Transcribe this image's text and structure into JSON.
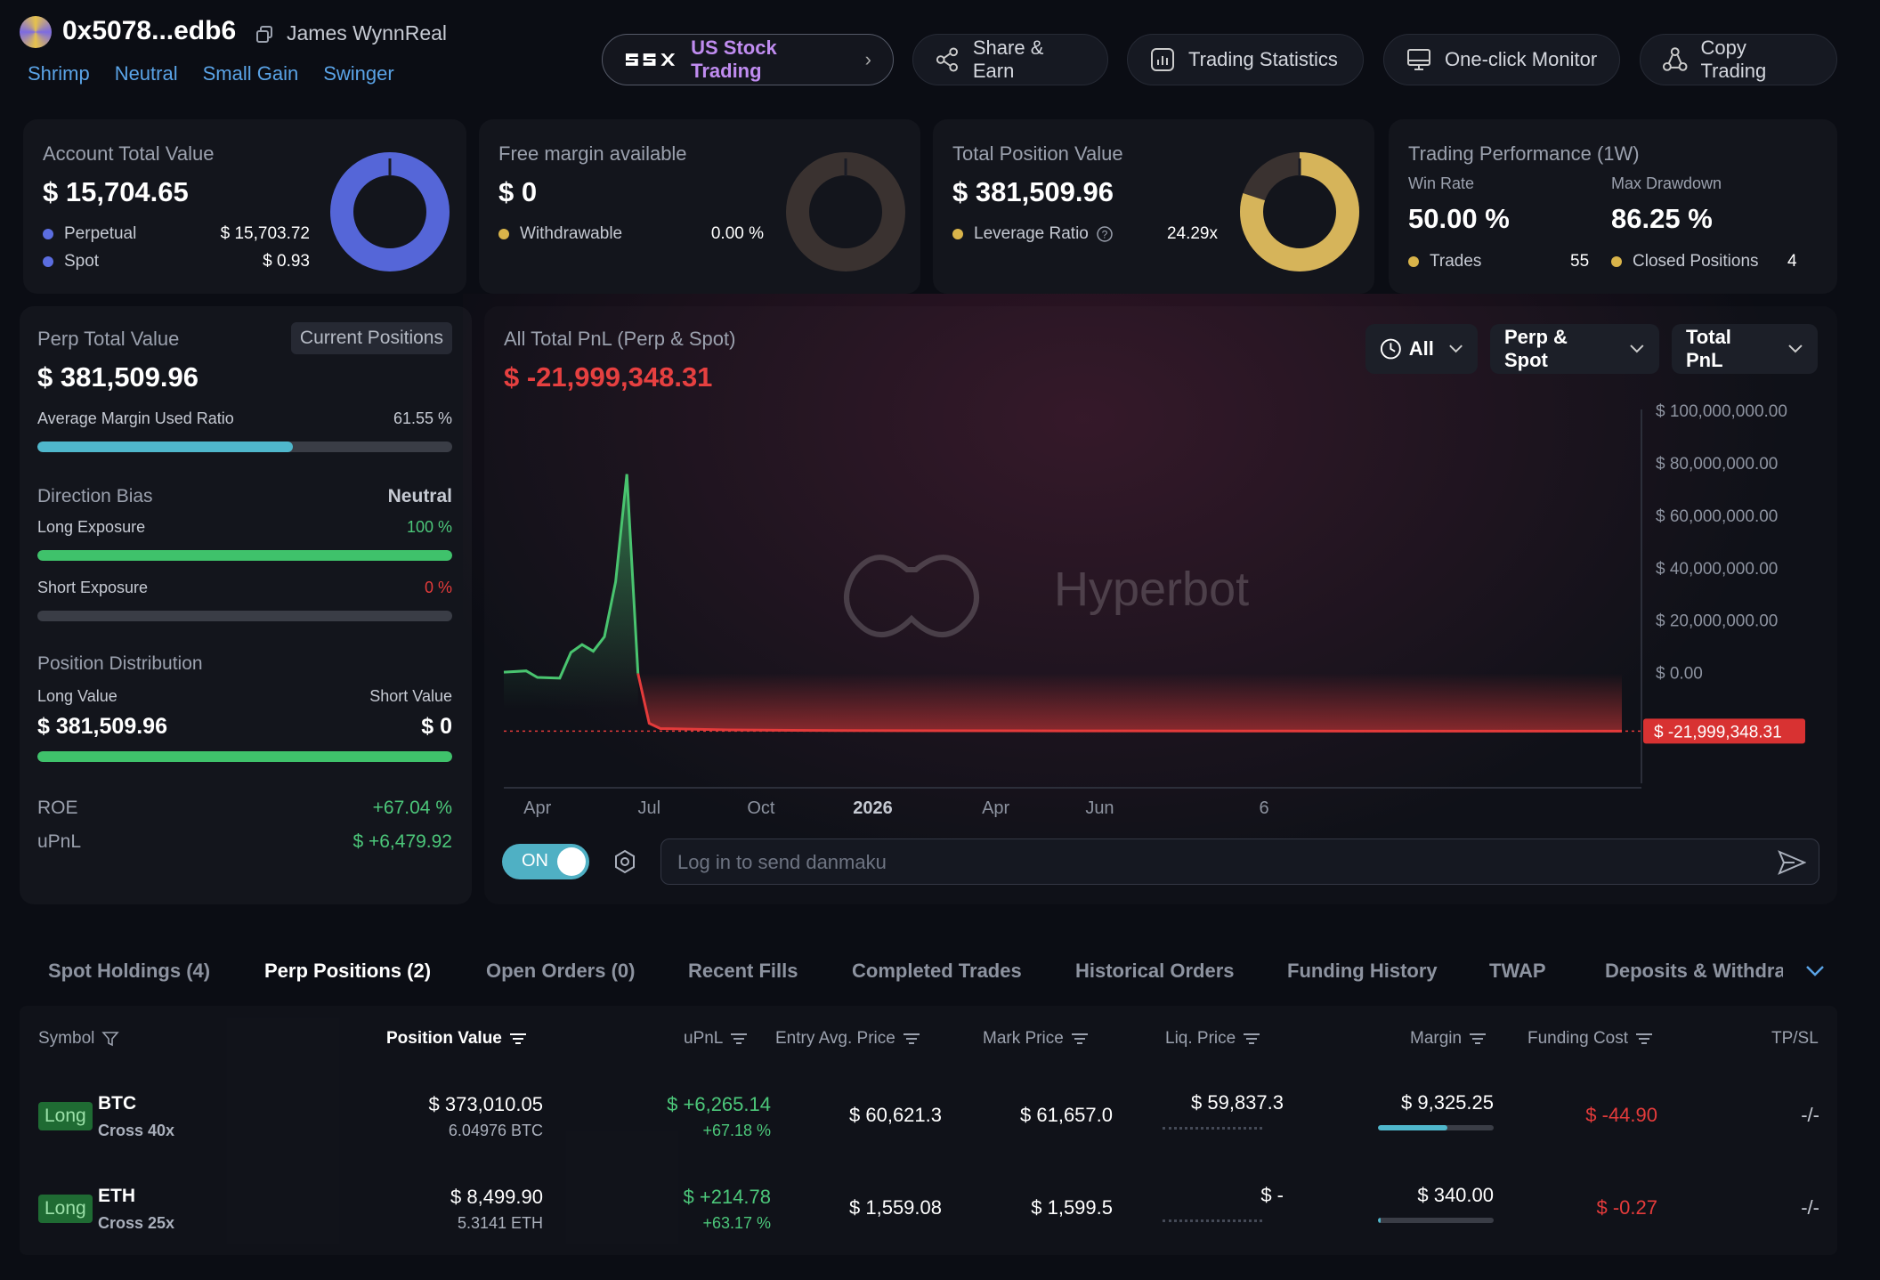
{
  "header": {
    "address": "0x5078...edb6",
    "name": "James WynnReal",
    "tags": [
      "Shrimp",
      "Neutral",
      "Small Gain",
      "Swinger"
    ]
  },
  "nav": {
    "us_stock": "US Stock Trading",
    "share": "Share & Earn",
    "stats": "Trading Statistics",
    "monitor": "One-click Monitor",
    "copy": "Copy Trading"
  },
  "summary": {
    "account": {
      "title": "Account Total Value",
      "value": "$ 15,704.65",
      "perp_label": "Perpetual",
      "perp_value": "$ 15,703.72",
      "spot_label": "Spot",
      "spot_value": "$ 0.93",
      "perp_share": 0.9999
    },
    "margin": {
      "title": "Free margin available",
      "value": "$ 0",
      "withdrawable_label": "Withdrawable",
      "withdrawable_value": "0.00 %",
      "fill": 0
    },
    "position": {
      "title": "Total Position Value",
      "value": "$ 381,509.96",
      "leverage_label": "Leverage Ratio",
      "leverage_value": "24.29x",
      "fill": 0.8
    },
    "performance": {
      "title": "Trading Performance (1W)",
      "win_rate_label": "Win Rate",
      "win_rate": "50.00 %",
      "drawdown_label": "Max Drawdown",
      "drawdown": "86.25 %",
      "trades_label": "Trades",
      "trades": "55",
      "closed_label": "Closed Positions",
      "closed": "4"
    }
  },
  "perp": {
    "title": "Perp Total Value",
    "button": "Current Positions",
    "value": "$ 381,509.96",
    "margin_label": "Average Margin Used Ratio",
    "margin_value": "61.55 %",
    "margin_ratio": 0.6155,
    "bias_label": "Direction Bias",
    "bias_value": "Neutral",
    "long_label": "Long Exposure",
    "long_value": "100 %",
    "long_ratio": 1.0,
    "short_label": "Short Exposure",
    "short_value": "0 %",
    "short_ratio": 0,
    "dist_label": "Position Distribution",
    "long_value_label": "Long Value",
    "short_value_label": "Short Value",
    "long_amount": "$ 381,509.96",
    "short_amount": "$ 0",
    "roe_label": "ROE",
    "roe": "+67.04 %",
    "upnl_label": "uPnL",
    "upnl": "$ +6,479.92"
  },
  "pnl": {
    "title": "All Total PnL (Perp & Spot)",
    "value": "$ -21,999,348.31",
    "filter_time": "All",
    "filter_market": "Perp & Spot",
    "filter_metric": "Total PnL",
    "watermark": "Hyperbot",
    "current_label": "$ -21,999,348.31",
    "toggle": "ON",
    "danmaku_placeholder": "Log in to send danmaku"
  },
  "chart_data": {
    "type": "area",
    "title": "All Total PnL (Perp & Spot)",
    "y_ticks": [
      "$ 100,000,000.00",
      "$ 80,000,000.00",
      "$ 60,000,000.00",
      "$ 40,000,000.00",
      "$ 20,000,000.00",
      "$ 0.00"
    ],
    "x_ticks": [
      "Apr",
      "Jul",
      "Oct",
      "2026",
      "Apr",
      "Jun",
      "6"
    ],
    "ylim": [
      -30000000,
      100000000
    ],
    "points": [
      [
        0,
        500000
      ],
      [
        0.02,
        1000000
      ],
      [
        0.03,
        -1500000
      ],
      [
        0.05,
        -1800000
      ],
      [
        0.06,
        8000000
      ],
      [
        0.07,
        11000000
      ],
      [
        0.08,
        8500000
      ],
      [
        0.09,
        14000000
      ],
      [
        0.1,
        35000000
      ],
      [
        0.11,
        76000000
      ],
      [
        0.12,
        0
      ],
      [
        0.13,
        -19000000
      ],
      [
        0.14,
        -21000000
      ],
      [
        0.2,
        -21500000
      ],
      [
        0.3,
        -21800000
      ],
      [
        0.5,
        -21900000
      ],
      [
        0.7,
        -21950000
      ],
      [
        0.9,
        -21990000
      ],
      [
        1,
        -21999348.31
      ]
    ]
  },
  "tabs": [
    "Spot Holdings (4)",
    "Perp Positions (2)",
    "Open Orders (0)",
    "Recent Fills",
    "Completed Trades",
    "Historical Orders",
    "Funding History",
    "TWAP",
    "Deposits & Withdraw"
  ],
  "columns": {
    "symbol": "Symbol",
    "position_value": "Position Value",
    "upnl": "uPnL",
    "entry": "Entry Avg. Price",
    "mark": "Mark Price",
    "liq": "Liq. Price",
    "margin": "Margin",
    "funding": "Funding Cost",
    "tpsl": "TP/SL"
  },
  "positions": [
    {
      "side": "Long",
      "symbol": "BTC",
      "mode": "Cross 40x",
      "value": "$ 373,010.05",
      "size": "6.04976 BTC",
      "upnl": "$ +6,265.14",
      "upnl_pct": "+67.18 %",
      "entry": "$ 60,621.3",
      "mark": "$ 61,657.0",
      "liq": "$ 59,837.3",
      "margin": "$ 9,325.25",
      "margin_ratio": 0.6,
      "funding": "$ -44.90",
      "tpsl": "-/-"
    },
    {
      "side": "Long",
      "symbol": "ETH",
      "mode": "Cross 25x",
      "value": "$ 8,499.90",
      "size": "5.3141 ETH",
      "upnl": "$ +214.78",
      "upnl_pct": "+63.17 %",
      "entry": "$ 1,559.08",
      "mark": "$ 1,599.5",
      "liq": "$ -",
      "margin": "$ 340.00",
      "margin_ratio": 0.02,
      "funding": "$ -0.27",
      "tpsl": "-/-"
    }
  ]
}
